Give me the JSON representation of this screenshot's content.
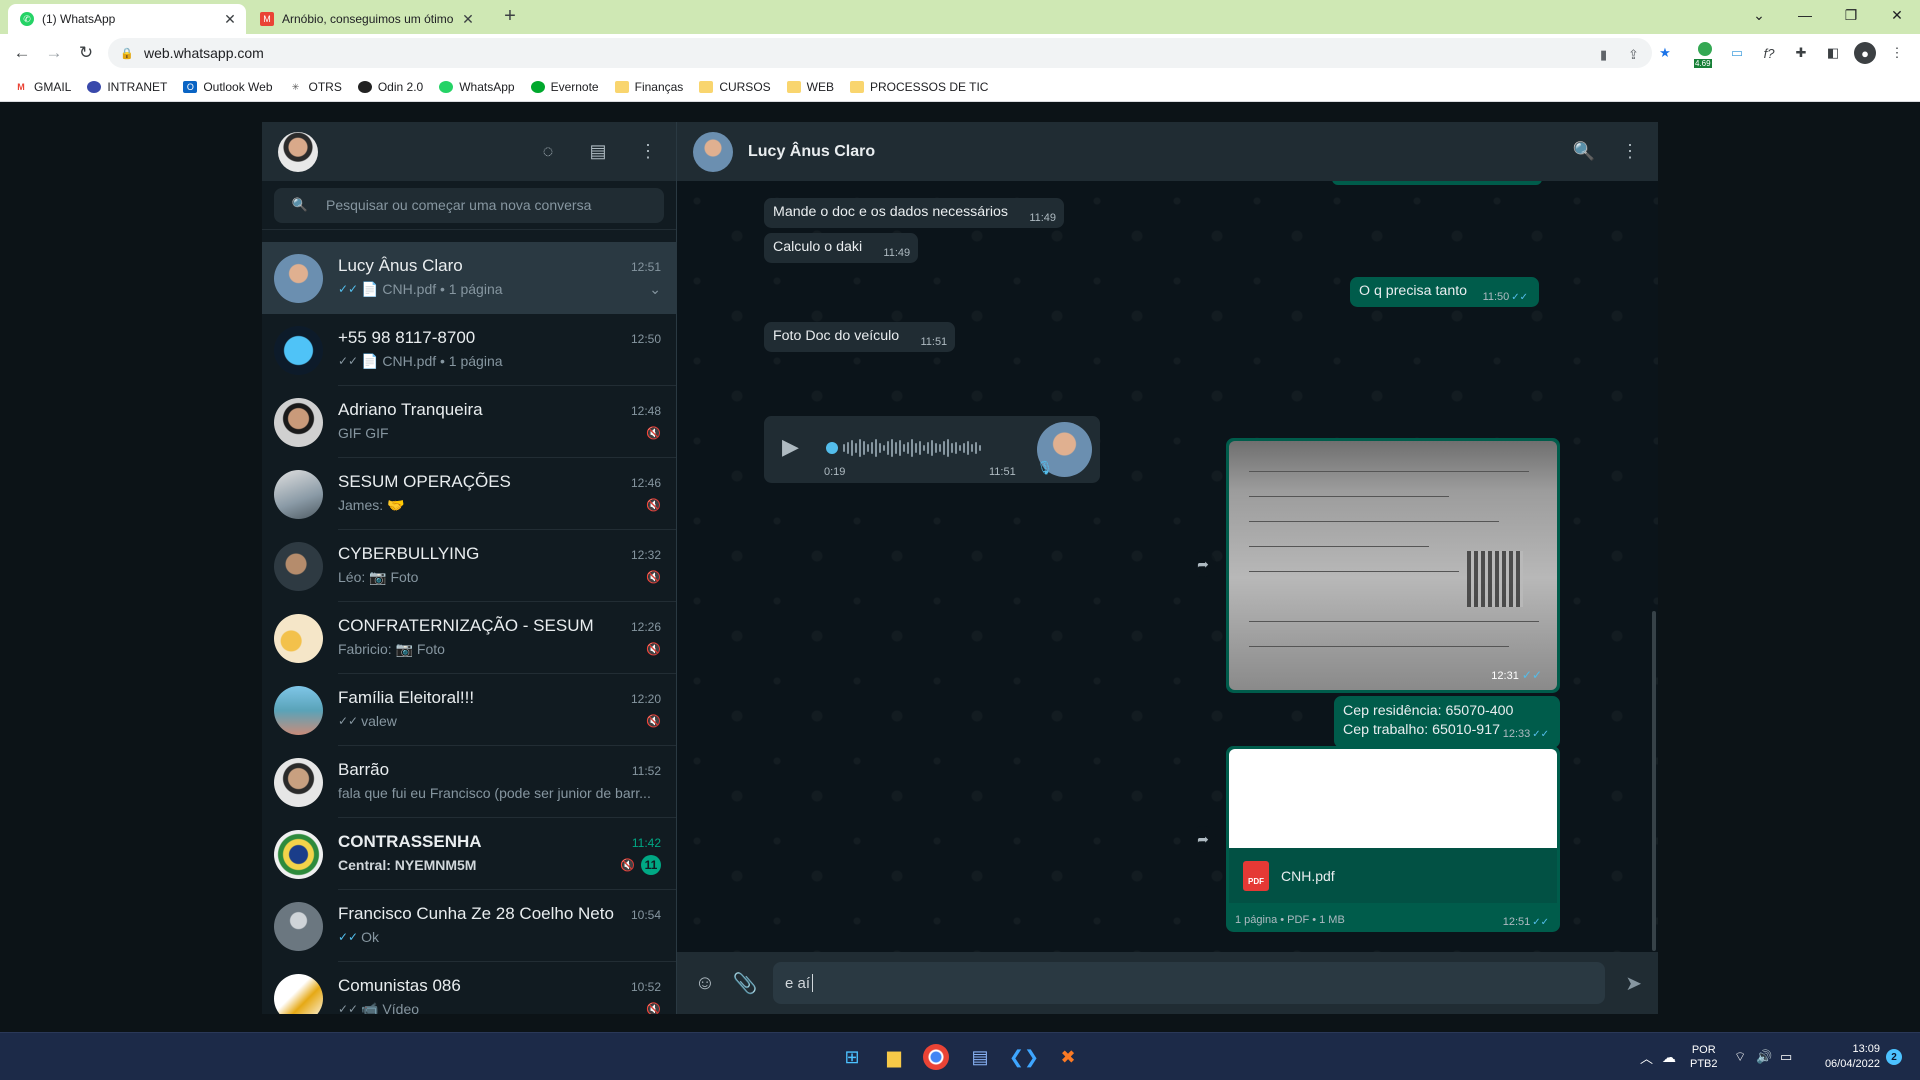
{
  "browser": {
    "tabs": [
      {
        "title": "(1) WhatsApp",
        "active": true
      },
      {
        "title": "Arnóbio, conseguimos um ótimo",
        "active": false
      }
    ],
    "url": "web.whatsapp.com",
    "extension_badge": "4.69",
    "bookmarks": [
      "GMAIL",
      "INTRANET",
      "Outlook Web",
      "OTRS",
      "Odin 2.0",
      "WhatsApp",
      "Evernote",
      "Finanças",
      "CURSOS",
      "WEB",
      "PROCESSOS DE TIC"
    ]
  },
  "sidebar": {
    "search_placeholder": "Pesquisar ou começar uma nova conversa",
    "chats": [
      {
        "name": "Lucy Ânus Claro",
        "time": "12:51",
        "preview": "📄 CNH.pdf • 1 página"
      },
      {
        "name": "+55 98 8117-8700",
        "time": "12:50",
        "preview": "📄 CNH.pdf • 1 página"
      },
      {
        "name": "Adriano Tranqueira",
        "time": "12:48",
        "preview": "GIF GIF"
      },
      {
        "name": "SESUM OPERAÇÕES",
        "time": "12:46",
        "preview": "James: 🤝"
      },
      {
        "name": "CYBERBULLYING",
        "time": "12:32",
        "preview": "Léo: 📷 Foto"
      },
      {
        "name": "CONFRATERNIZAÇÃO - SESUM",
        "time": "12:26",
        "preview": "Fabricio: 📷 Foto"
      },
      {
        "name": "Família Eleitoral!!!",
        "time": "12:20",
        "preview": "valew"
      },
      {
        "name": "Barrão",
        "time": "11:52",
        "preview": "fala que fui eu Francisco (pode ser junior de barr..."
      },
      {
        "name": "CONTRASSENHA",
        "time": "11:42",
        "preview": "Central: NYEMNM5M",
        "unread": "11"
      },
      {
        "name": "Francisco Cunha Ze 28 Coelho Neto",
        "time": "10:54",
        "preview": "Ok"
      },
      {
        "name": "Comunistas 086",
        "time": "10:52",
        "preview": "📹 Vídeo"
      }
    ]
  },
  "conversation": {
    "contact": "Lucy Ânus Claro",
    "messages": {
      "m1": {
        "text": "Mande o doc e os dados necessários",
        "time": "11:49"
      },
      "m2": {
        "text": "Calculo o daki",
        "time": "11:49"
      },
      "m3": {
        "text": "O q precisa tanto",
        "time": "11:50"
      },
      "m4": {
        "text": "Foto Doc do veículo",
        "time": "11:51"
      },
      "audio": {
        "duration": "0:19",
        "time": "11:51"
      },
      "image": {
        "time": "12:31"
      },
      "cep1": "Cep residência: 65070-400",
      "cep2": "Cep trabalho:  65010-917",
      "cep_time": "12:33",
      "doc": {
        "name": "CNH.pdf",
        "meta": "1 página • PDF • 1 MB",
        "time": "12:51",
        "icon_label": "PDF"
      }
    },
    "composer_text": "e aí"
  },
  "taskbar": {
    "lang": "POR",
    "layout": "PTB2",
    "time": "13:09",
    "date": "06/04/2022",
    "notifications": "2"
  }
}
